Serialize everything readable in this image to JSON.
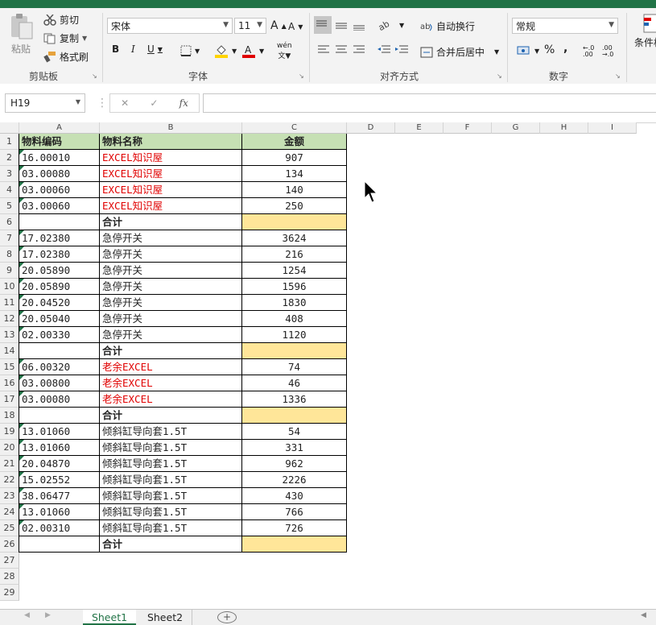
{
  "ribbon": {
    "clipboard": {
      "paste": "粘贴",
      "cut": "剪切",
      "copy": "复制",
      "format_painter": "格式刷",
      "label": "剪贴板"
    },
    "font": {
      "name": "宋体",
      "size": "11",
      "grow": "A",
      "shrink": "A",
      "bold": "B",
      "italic": "I",
      "underline": "U",
      "label": "字体",
      "phonetic": "wén"
    },
    "alignment": {
      "wrap_text": "自动换行",
      "merge_center": "合并后居中",
      "label": "对齐方式"
    },
    "number": {
      "format": "常规",
      "percent": "%",
      "comma": ",",
      "label": "数字",
      "inc_decimal": "←.0 .00",
      "dec_decimal": ".00 →.0"
    },
    "styles": {
      "conditional": "条件格"
    }
  },
  "formula_bar": {
    "name_box": "H19",
    "fx": "fx",
    "formula": ""
  },
  "columns": [
    "A",
    "B",
    "C",
    "D",
    "E",
    "F",
    "G",
    "H",
    "I"
  ],
  "rows": [
    "1",
    "2",
    "3",
    "4",
    "5",
    "6",
    "7",
    "8",
    "9",
    "10",
    "11",
    "12",
    "13",
    "14",
    "15",
    "16",
    "17",
    "18",
    "19",
    "20",
    "21",
    "22",
    "23",
    "24",
    "25",
    "26",
    "27",
    "28",
    "29"
  ],
  "table": {
    "headers": [
      "物料编码",
      "物料名称",
      "金额"
    ],
    "rows": [
      {
        "code": "16.00010",
        "name": "EXCEL知识屋",
        "amount": "907",
        "red": true,
        "subtotal": false
      },
      {
        "code": "03.00080",
        "name": "EXCEL知识屋",
        "amount": "134",
        "red": true,
        "subtotal": false
      },
      {
        "code": "03.00060",
        "name": "EXCEL知识屋",
        "amount": "140",
        "red": true,
        "subtotal": false
      },
      {
        "code": "03.00060",
        "name": "EXCEL知识屋",
        "amount": "250",
        "red": true,
        "subtotal": false
      },
      {
        "code": "",
        "name": "合计",
        "amount": "",
        "red": false,
        "subtotal": true
      },
      {
        "code": "17.02380",
        "name": "急停开关",
        "amount": "3624",
        "red": false,
        "subtotal": false
      },
      {
        "code": "17.02380",
        "name": "急停开关",
        "amount": "216",
        "red": false,
        "subtotal": false
      },
      {
        "code": "20.05890",
        "name": "急停开关",
        "amount": "1254",
        "red": false,
        "subtotal": false
      },
      {
        "code": "20.05890",
        "name": "急停开关",
        "amount": "1596",
        "red": false,
        "subtotal": false
      },
      {
        "code": "20.04520",
        "name": "急停开关",
        "amount": "1830",
        "red": false,
        "subtotal": false
      },
      {
        "code": "20.05040",
        "name": "急停开关",
        "amount": "408",
        "red": false,
        "subtotal": false
      },
      {
        "code": "02.00330",
        "name": "急停开关",
        "amount": "1120",
        "red": false,
        "subtotal": false
      },
      {
        "code": "",
        "name": "合计",
        "amount": "",
        "red": false,
        "subtotal": true
      },
      {
        "code": "06.00320",
        "name": "老余EXCEL",
        "amount": "74",
        "red": true,
        "subtotal": false
      },
      {
        "code": "03.00800",
        "name": "老余EXCEL",
        "amount": "46",
        "red": true,
        "subtotal": false
      },
      {
        "code": "03.00080",
        "name": "老余EXCEL",
        "amount": "1336",
        "red": true,
        "subtotal": false
      },
      {
        "code": "",
        "name": "合计",
        "amount": "",
        "red": false,
        "subtotal": true
      },
      {
        "code": "13.01060",
        "name": "倾斜缸导向套1.5T",
        "amount": "54",
        "red": false,
        "subtotal": false
      },
      {
        "code": "13.01060",
        "name": "倾斜缸导向套1.5T",
        "amount": "331",
        "red": false,
        "subtotal": false
      },
      {
        "code": "20.04870",
        "name": "倾斜缸导向套1.5T",
        "amount": "962",
        "red": false,
        "subtotal": false
      },
      {
        "code": "15.02552",
        "name": "倾斜缸导向套1.5T",
        "amount": "2226",
        "red": false,
        "subtotal": false
      },
      {
        "code": "38.06477",
        "name": "倾斜缸导向套1.5T",
        "amount": "430",
        "red": false,
        "subtotal": false
      },
      {
        "code": "13.01060",
        "name": "倾斜缸导向套1.5T",
        "amount": "766",
        "red": false,
        "subtotal": false
      },
      {
        "code": "02.00310",
        "name": "倾斜缸导向套1.5T",
        "amount": "726",
        "red": false,
        "subtotal": false
      },
      {
        "code": "",
        "name": "合计",
        "amount": "",
        "red": false,
        "subtotal": true
      }
    ]
  },
  "sheets": {
    "sheet1": "Sheet1",
    "sheet2": "Sheet2",
    "add": "+"
  },
  "colors": {
    "excel_green": "#217346",
    "header_fill": "#c6e0b4",
    "subtotal_fill": "#ffe699",
    "red_text": "#e00000"
  }
}
